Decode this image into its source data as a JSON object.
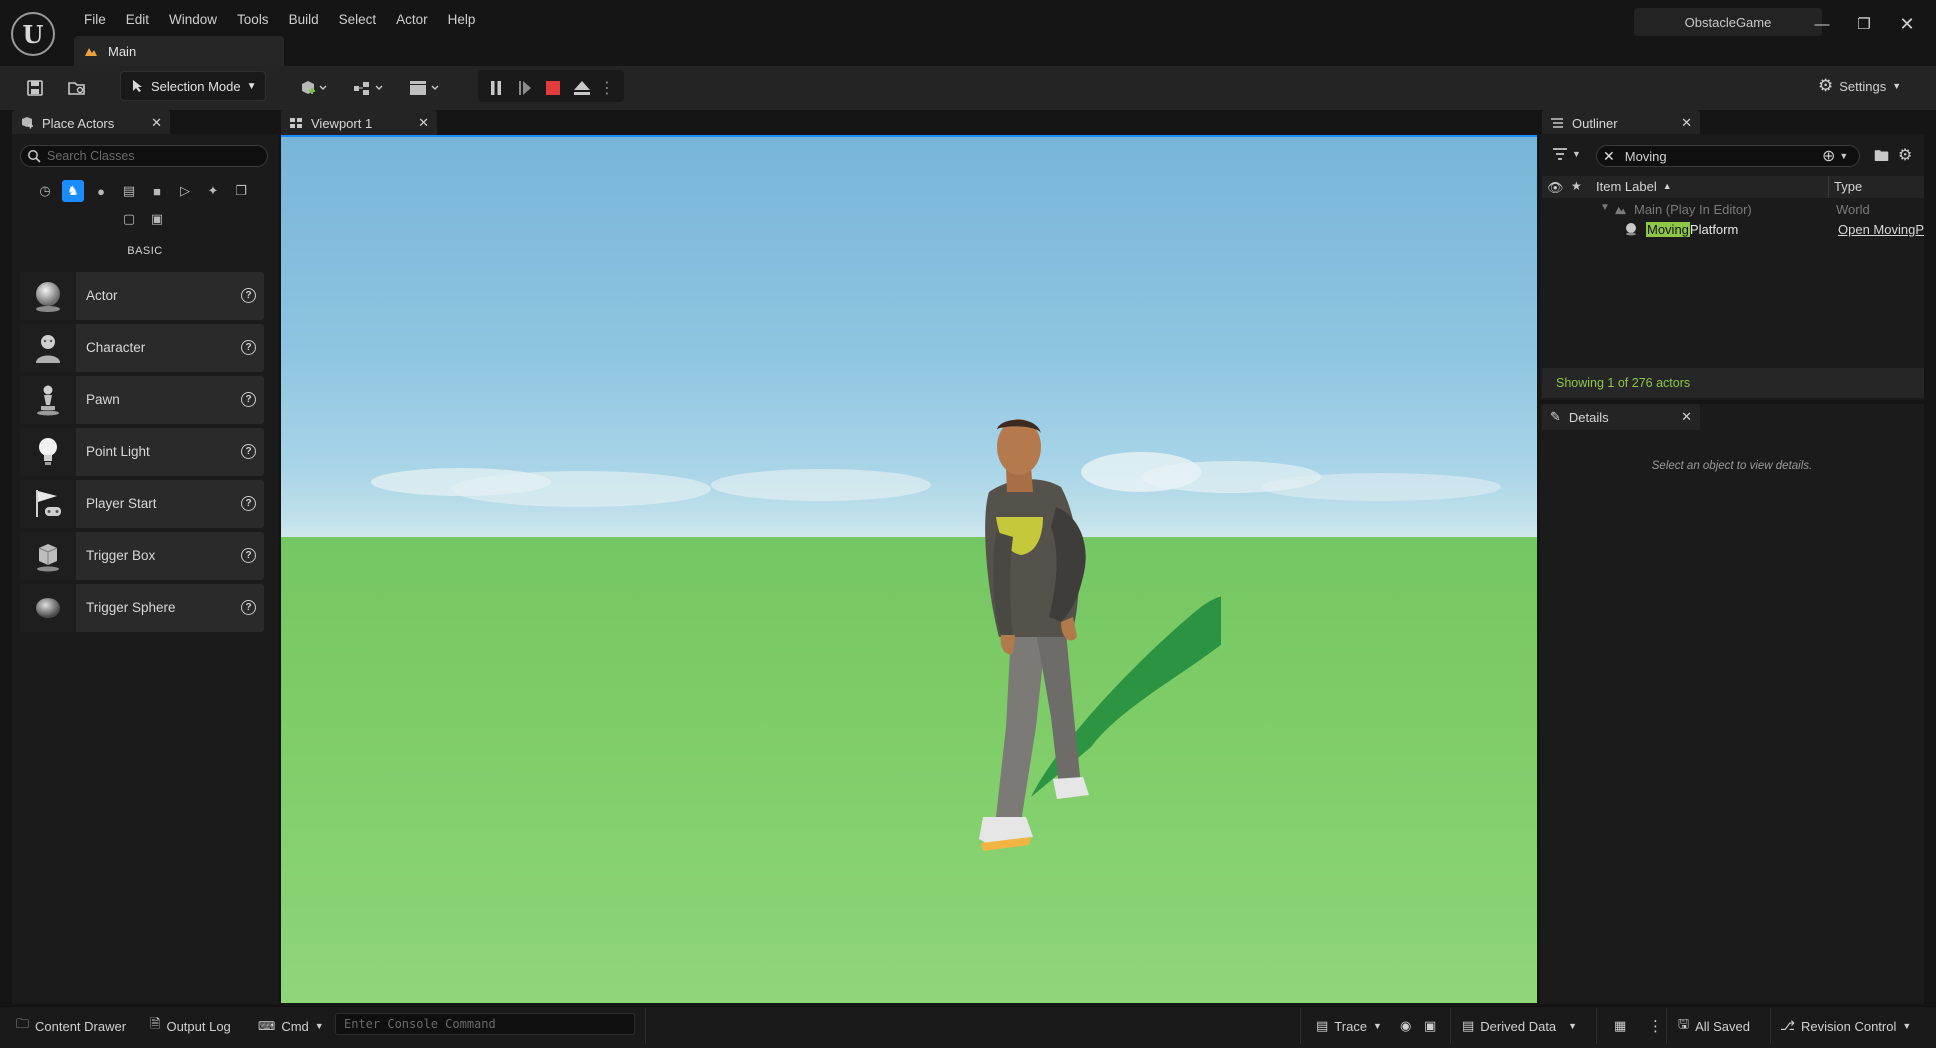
{
  "app": {
    "project_name": "ObstacleGame",
    "level_tab": "Main",
    "menu": [
      "File",
      "Edit",
      "Window",
      "Tools",
      "Build",
      "Select",
      "Actor",
      "Help"
    ]
  },
  "toolbar": {
    "selection_mode": "Selection Mode",
    "settings": "Settings"
  },
  "place_actors": {
    "tab_title": "Place Actors",
    "search_placeholder": "Search Classes",
    "category_label": "BASIC",
    "items": [
      {
        "label": "Actor",
        "icon": "sphere-icon"
      },
      {
        "label": "Character",
        "icon": "character-icon"
      },
      {
        "label": "Pawn",
        "icon": "pawn-icon"
      },
      {
        "label": "Point Light",
        "icon": "light-bulb-icon"
      },
      {
        "label": "Player Start",
        "icon": "player-start-icon"
      },
      {
        "label": "Trigger Box",
        "icon": "trigger-box-icon"
      },
      {
        "label": "Trigger Sphere",
        "icon": "trigger-sphere-icon"
      }
    ]
  },
  "viewport": {
    "tab_title": "Viewport 1"
  },
  "outliner": {
    "tab_title": "Outliner",
    "filter_text": "Moving",
    "col_label": "Item Label",
    "col_type": "Type",
    "rows": [
      {
        "label": "Main (Play In Editor)",
        "type": "World"
      },
      {
        "label_highlight": "Moving",
        "label_rest": "Platform",
        "type": "Open MovingPl"
      }
    ],
    "showing": "Showing 1 of 276 actors"
  },
  "details": {
    "tab_title": "Details",
    "empty_text": "Select an object to view details."
  },
  "statusbar": {
    "content_drawer": "Content Drawer",
    "output_log": "Output Log",
    "cmd": "Cmd",
    "console_placeholder": "Enter Console Command",
    "trace": "Trace",
    "derived_data": "Derived Data",
    "all_saved": "All Saved",
    "revision_control": "Revision Control"
  },
  "colors": {
    "accent_blue": "#1a8cff",
    "stop_red": "#e23b3b",
    "filter_highlight": "#8ec646"
  }
}
